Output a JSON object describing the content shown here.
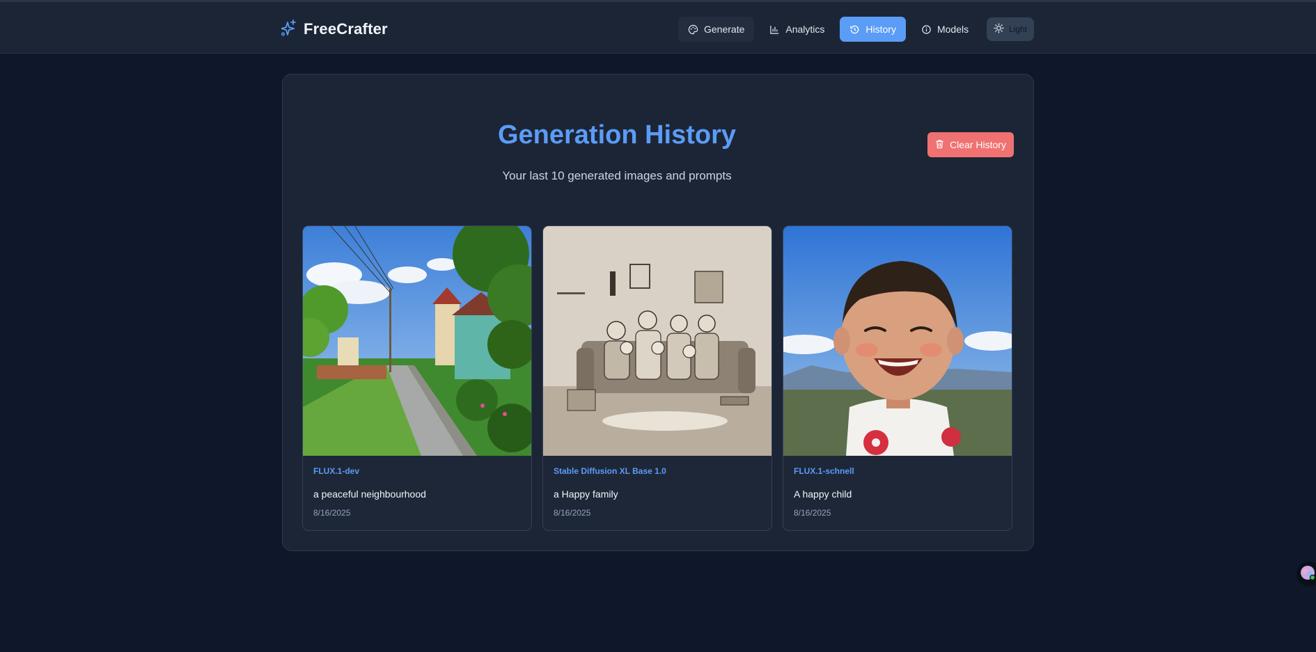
{
  "brand": {
    "name": "FreeCrafter"
  },
  "nav": {
    "items": [
      {
        "label": "Generate",
        "icon": "palette-icon"
      },
      {
        "label": "Analytics",
        "icon": "bar-chart-icon"
      },
      {
        "label": "History",
        "icon": "history-icon",
        "active": true
      },
      {
        "label": "Models",
        "icon": "info-icon"
      }
    ],
    "theme_label": "Light"
  },
  "history": {
    "title": "Generation History",
    "subtitle": "Your last 10 generated images and prompts",
    "clear_label": "Clear History",
    "items": [
      {
        "model": "FLUX.1-dev",
        "prompt": "a peaceful neighbourhood",
        "date": "8/16/2025"
      },
      {
        "model": "Stable Diffusion XL Base 1.0",
        "prompt": "a Happy family",
        "date": "8/16/2025"
      },
      {
        "model": "FLUX.1-schnell",
        "prompt": "A happy child",
        "date": "8/16/2025"
      }
    ]
  },
  "colors": {
    "accent": "#5b9cf6",
    "danger": "#f07171",
    "background": "#0f172a",
    "surface": "#1c2536"
  }
}
